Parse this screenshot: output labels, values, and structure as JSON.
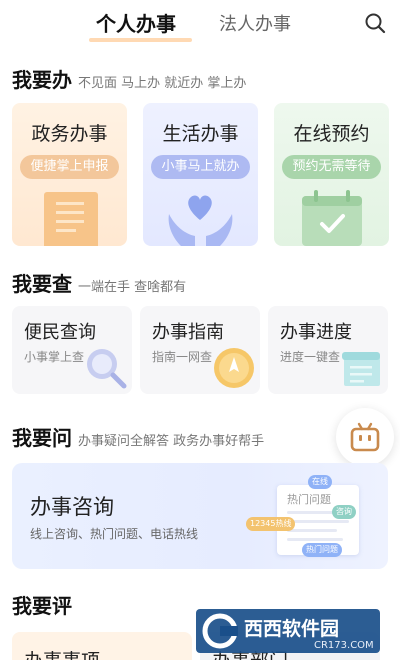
{
  "tabs": {
    "active": "个人办事",
    "inactive": "法人办事"
  },
  "sections": {
    "ban": {
      "title": "我要办",
      "subtitle": "不见面 马上办 就近办 掌上办",
      "cards": [
        {
          "title": "政务办事",
          "pill": "便捷掌上申报",
          "icon": "document-icon"
        },
        {
          "title": "生活办事",
          "pill": "小事马上就办",
          "icon": "heart-hands-icon"
        },
        {
          "title": "在线预约",
          "pill": "预约无需等待",
          "icon": "calendar-check-icon"
        }
      ]
    },
    "cha": {
      "title": "我要查",
      "subtitle": "一端在手 查啥都有",
      "cards": [
        {
          "title": "便民查询",
          "subtitle": "小事掌上查",
          "icon": "magnifier-icon"
        },
        {
          "title": "办事指南",
          "subtitle": "指南一网查",
          "icon": "compass-icon"
        },
        {
          "title": "办事进度",
          "subtitle": "进度一键查",
          "icon": "scroll-icon"
        }
      ]
    },
    "wen": {
      "title": "我要问",
      "subtitle": "办事疑问全解答 政务办事好帮手",
      "banner": {
        "title": "办事咨询",
        "subtitle": "线上咨询、热门问题、电话热线",
        "doc_title": "热门问题",
        "bubbles": [
          "在线",
          "咨询",
          "12345热线",
          "热门问题"
        ]
      }
    },
    "ping": {
      "title": "我要评",
      "cards": [
        {
          "title": "办事事项"
        },
        {
          "title": "办事部门"
        }
      ]
    }
  },
  "watermark": {
    "brand": "西西软件园",
    "domain": "CR173.COM"
  },
  "colors": {
    "accent_orange": "#f3c79b",
    "accent_blue": "#aebaf2",
    "accent_green": "#a9d5ab"
  }
}
